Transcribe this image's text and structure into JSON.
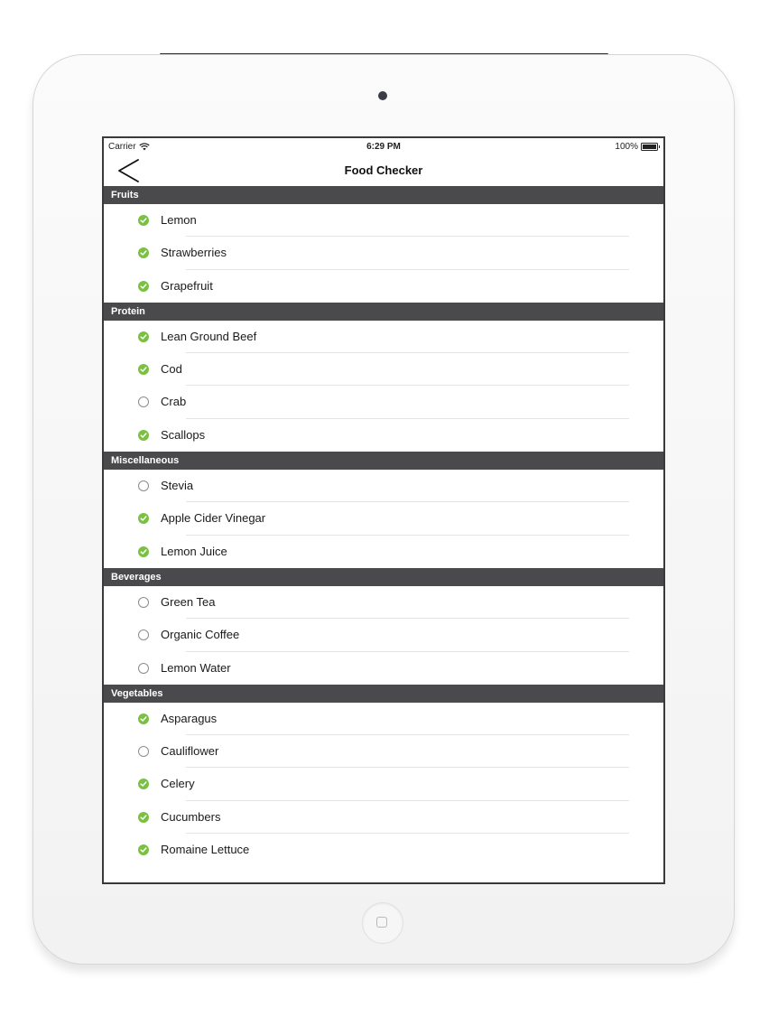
{
  "status_bar": {
    "carrier": "Carrier",
    "time": "6:29 PM",
    "battery": "100%"
  },
  "nav": {
    "title": "Food Checker"
  },
  "sections": [
    {
      "title": "Fruits",
      "items": [
        {
          "label": "Lemon",
          "checked": true
        },
        {
          "label": "Strawberries",
          "checked": true
        },
        {
          "label": "Grapefruit",
          "checked": true
        }
      ]
    },
    {
      "title": "Protein",
      "items": [
        {
          "label": "Lean Ground Beef",
          "checked": true
        },
        {
          "label": "Cod",
          "checked": true
        },
        {
          "label": "Crab",
          "checked": false
        },
        {
          "label": "Scallops",
          "checked": true
        }
      ]
    },
    {
      "title": "Miscellaneous",
      "items": [
        {
          "label": "Stevia",
          "checked": false
        },
        {
          "label": "Apple Cider Vinegar",
          "checked": true
        },
        {
          "label": "Lemon Juice",
          "checked": true
        }
      ]
    },
    {
      "title": "Beverages",
      "items": [
        {
          "label": "Green Tea",
          "checked": false
        },
        {
          "label": "Organic Coffee",
          "checked": false
        },
        {
          "label": "Lemon Water",
          "checked": false
        }
      ]
    },
    {
      "title": "Vegetables",
      "items": [
        {
          "label": "Asparagus",
          "checked": true
        },
        {
          "label": "Cauliflower",
          "checked": false
        },
        {
          "label": "Celery",
          "checked": true
        },
        {
          "label": "Cucumbers",
          "checked": true
        },
        {
          "label": "Romaine Lettuce",
          "checked": true
        }
      ]
    }
  ],
  "colors": {
    "checked": "#7ac142",
    "section_header": "#4a4a4c"
  },
  "icons": {
    "back": "chevron-left-icon",
    "checked": "checkmark-circle-icon",
    "unchecked": "empty-circle-icon",
    "wifi": "wifi-icon",
    "battery": "battery-icon"
  }
}
